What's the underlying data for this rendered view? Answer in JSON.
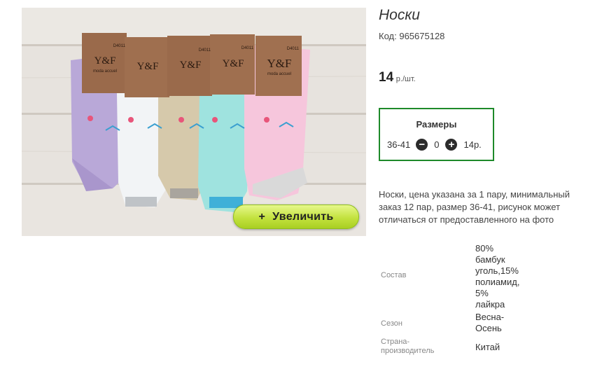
{
  "product": {
    "title": "Носки",
    "code_label": "Код:",
    "code_value": "965675128",
    "price_value": "14",
    "price_unit": "р./шт.",
    "description": "Носки, цена указана за 1 пару, минимальный заказ 12 пар, размер 36-41, рисунок может отличаться от предоставленного на фото"
  },
  "photo": {
    "zoom_button_label": "Увеличить",
    "zoom_button_icon": "+",
    "tag_brand": "Y&F",
    "tag_sub": "moda accuel",
    "tag_code": "D4011"
  },
  "sizes": {
    "title": "Размеры",
    "rows": [
      {
        "size": "36-41",
        "quantity": "0",
        "price": "14р."
      }
    ]
  },
  "properties": [
    {
      "key": "Состав",
      "value": [
        "80%",
        "бамбук",
        "уголь,15%",
        "полиамид,",
        "5%",
        "лайкра"
      ]
    },
    {
      "key": "Сезон",
      "value": [
        "Весна-",
        "Осень"
      ]
    },
    {
      "key": [
        "Страна-",
        "производитель"
      ],
      "value": [
        "Китай"
      ]
    }
  ],
  "colors": {
    "accent_border": "#1e8a2a",
    "zoom_button": "#c3e23f",
    "sock_colors": [
      "#b9a8d8",
      "#f2f4f6",
      "#d6c9ab",
      "#9fe3df",
      "#f6c6dc"
    ]
  }
}
